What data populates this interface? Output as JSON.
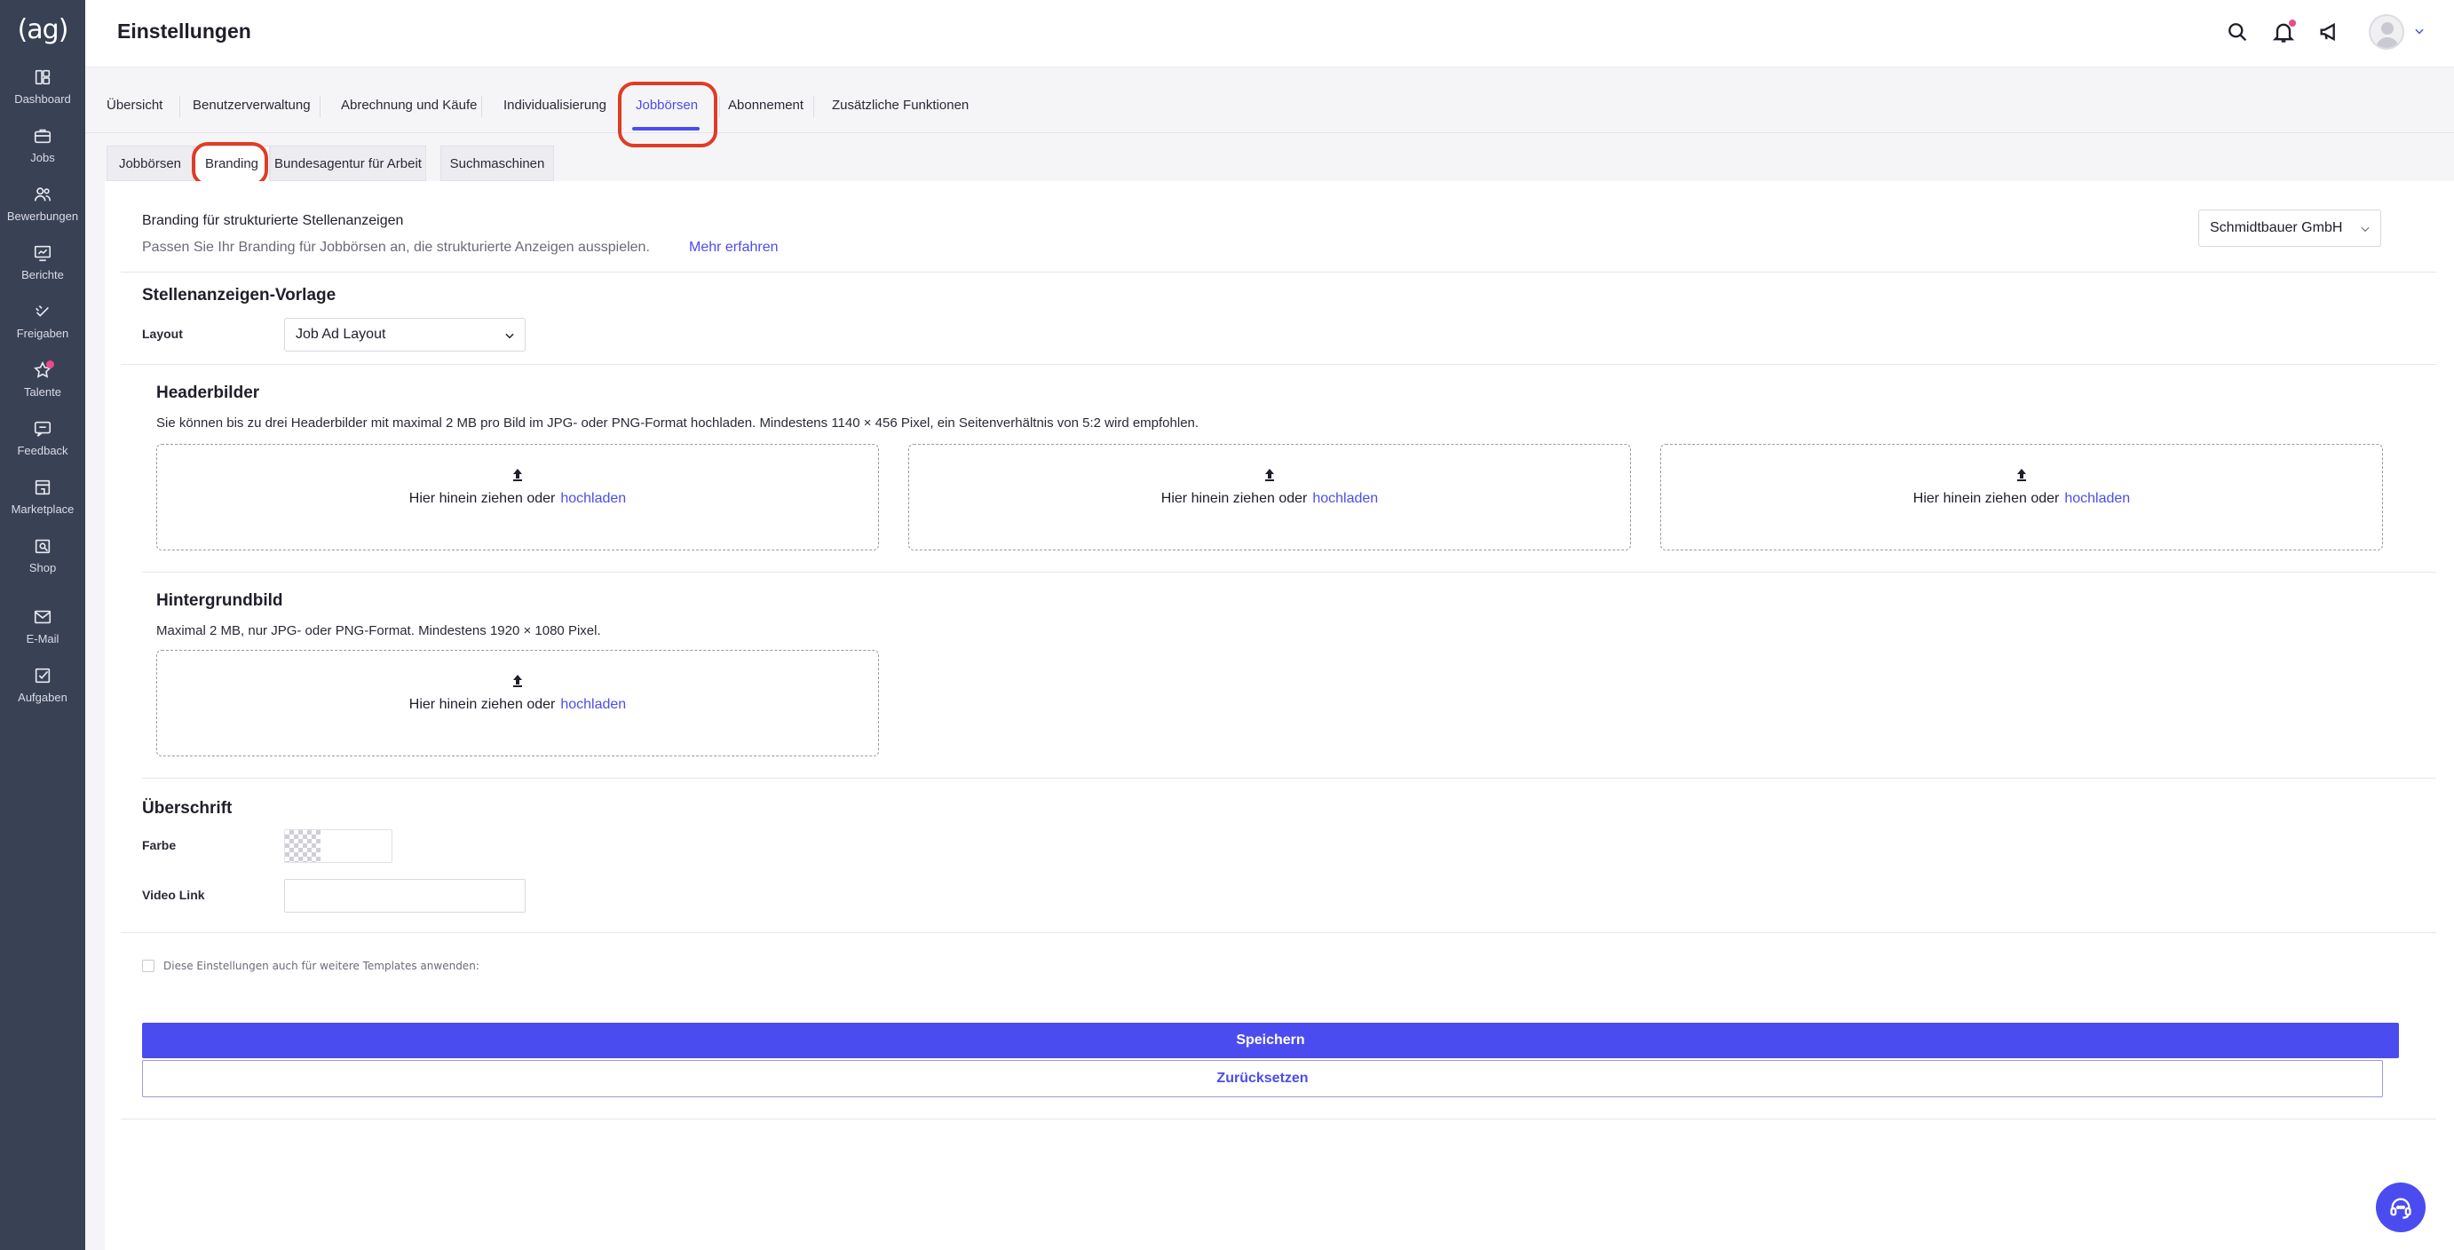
{
  "app": {
    "logo_text": "(ag)"
  },
  "sidebar": {
    "items": [
      {
        "label": "Dashboard",
        "icon": "dashboard-icon"
      },
      {
        "label": "Jobs",
        "icon": "briefcase-icon"
      },
      {
        "label": "Bewerbungen",
        "icon": "users-icon"
      },
      {
        "label": "Berichte",
        "icon": "chart-icon"
      },
      {
        "label": "Freigaben",
        "icon": "approval-icon"
      },
      {
        "label": "Talente",
        "icon": "star-icon"
      },
      {
        "label": "Feedback",
        "icon": "chat-icon"
      },
      {
        "label": "Marketplace",
        "icon": "store-icon"
      },
      {
        "label": "Shop",
        "icon": "shop-icon"
      },
      {
        "label": "E-Mail",
        "icon": "mail-icon"
      },
      {
        "label": "Aufgaben",
        "icon": "task-icon"
      }
    ]
  },
  "header": {
    "title": "Einstellungen"
  },
  "main_tabs": [
    {
      "label": "Übersicht"
    },
    {
      "label": "Benutzerverwaltung"
    },
    {
      "label": "Abrechnung und Käufe"
    },
    {
      "label": "Individualisierung"
    },
    {
      "label": "Jobbörsen",
      "active": true
    },
    {
      "label": "Abonnement"
    },
    {
      "label": "Zusätzliche Funktionen"
    }
  ],
  "sub_tabs": [
    {
      "label": "Jobbörsen"
    },
    {
      "label": "Branding",
      "active": true
    },
    {
      "label": "Bundesagentur für Arbeit"
    },
    {
      "label": "Suchmaschinen"
    }
  ],
  "branding": {
    "title": "Branding für strukturierte Stellenanzeigen",
    "description": "Passen Sie Ihr Branding für Jobbörsen an, die strukturierte Anzeigen ausspielen.",
    "learn_more": "Mehr erfahren",
    "company": "Schmidtbauer GmbH"
  },
  "template": {
    "heading": "Stellenanzeigen-Vorlage",
    "layout_label": "Layout",
    "layout_value": "Job Ad Layout"
  },
  "header_images": {
    "heading": "Headerbilder",
    "description": "Sie können bis zu drei Headerbilder mit maximal 2 MB pro Bild im JPG- oder PNG-Format hochladen. Mindestens 1140 × 456 Pixel, ein Seitenverhältnis von 5:2 wird empfohlen.",
    "drop_text": "Hier hinein ziehen oder",
    "upload_link": "hochladen"
  },
  "background": {
    "heading": "Hintergrundbild",
    "description": "Maximal 2 MB, nur JPG- oder PNG-Format. Mindestens 1920 × 1080 Pixel.",
    "drop_text": "Hier hinein ziehen oder",
    "upload_link": "hochladen"
  },
  "headline": {
    "heading": "Überschrift",
    "color_label": "Farbe",
    "video_label": "Video Link",
    "video_value": ""
  },
  "apply_checkbox": {
    "label": "Diese Einstellungen auch für weitere Templates anwenden:",
    "checked": false
  },
  "actions": {
    "save": "Speichern",
    "reset": "Zurücksetzen"
  },
  "colors": {
    "accent": "#4b4cf0",
    "sidebar": "#394155",
    "annotation": "#e03c25",
    "badge": "#ec4a8a"
  }
}
